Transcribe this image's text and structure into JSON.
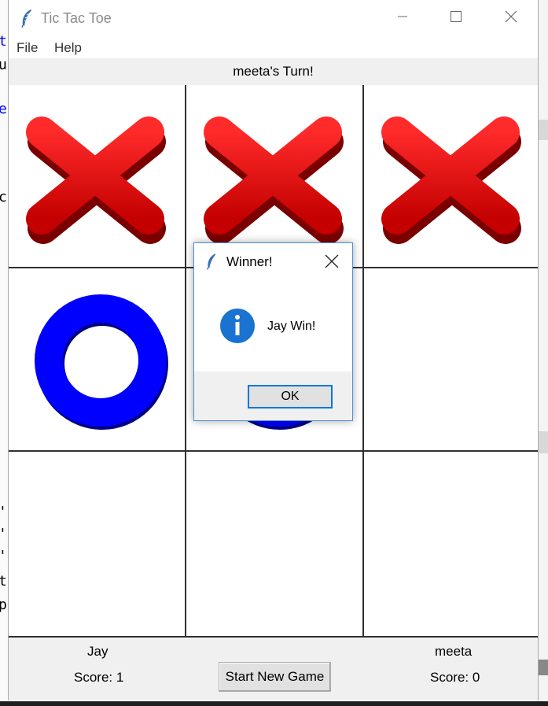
{
  "window": {
    "title": "Tic Tac Toe"
  },
  "menu": {
    "items": [
      "File",
      "Help"
    ]
  },
  "status": {
    "turn_text": "meeta's Turn!"
  },
  "board": {
    "cells": [
      "X",
      "X",
      "X",
      "O",
      "O",
      "",
      "",
      "",
      ""
    ]
  },
  "players": [
    {
      "name": "Jay",
      "score_text": "Score: 1"
    },
    {
      "name": "meeta",
      "score_text": "Score: 0"
    }
  ],
  "footer": {
    "new_game_label": "Start New Game"
  },
  "dialog": {
    "title": "Winner!",
    "message": "Jay Win!",
    "ok_label": "OK"
  },
  "colors": {
    "x_mark": "#ff0000",
    "o_mark": "#0000ff",
    "grid": "#303030",
    "focus_blue": "#0078d7"
  }
}
